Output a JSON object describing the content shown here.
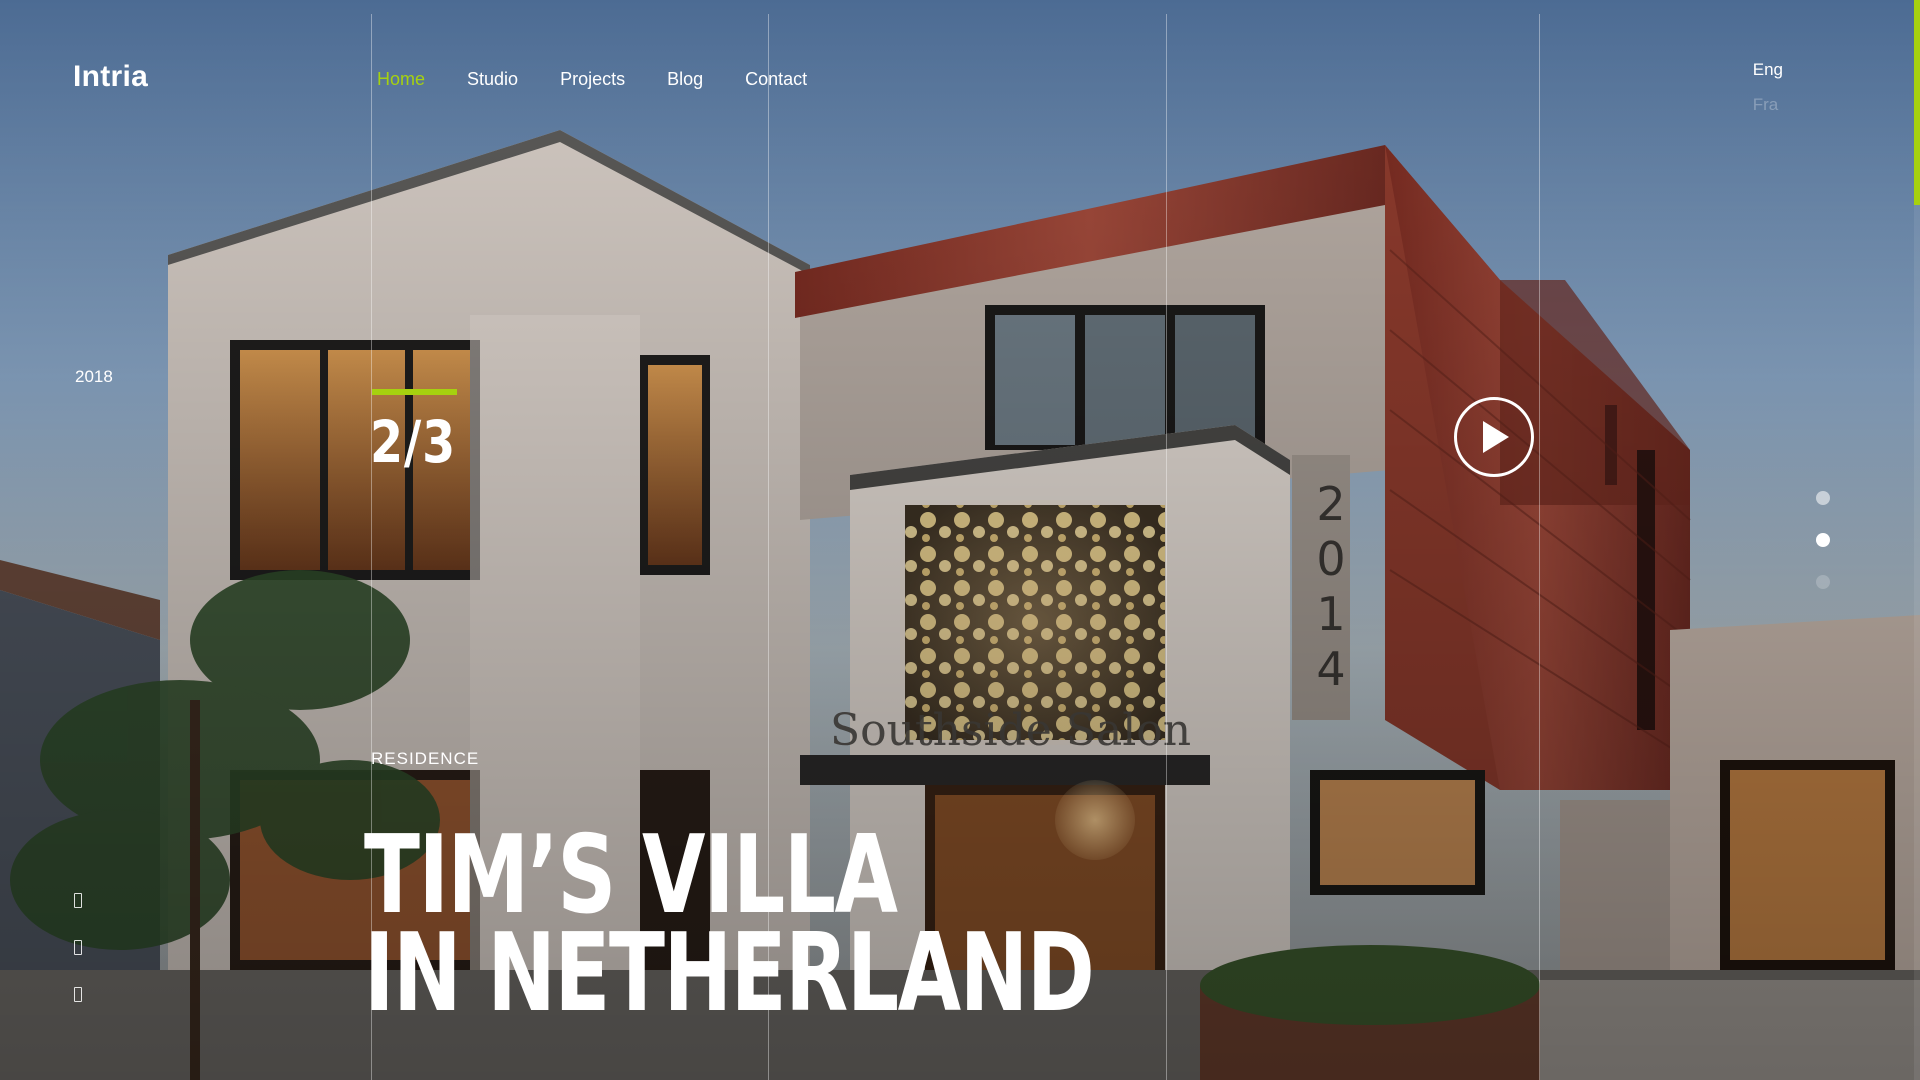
{
  "brand": {
    "logo": "Intria",
    "accent_color": "#a6d10f"
  },
  "nav": {
    "items": [
      {
        "label": "Home",
        "active": true
      },
      {
        "label": "Studio",
        "active": false
      },
      {
        "label": "Projects",
        "active": false
      },
      {
        "label": "Blog",
        "active": false
      },
      {
        "label": "Contact",
        "active": false
      }
    ]
  },
  "languages": {
    "current": "Eng",
    "other": "Fra"
  },
  "sidebar": {
    "year": "2018",
    "social_icons": [
      "facebook-icon",
      "twitter-icon",
      "instagram-icon"
    ]
  },
  "slide": {
    "counter": "2/3",
    "category": "RESIDENCE",
    "title_line1": "TIM’S VILLA",
    "title_line2": "IN NETHERLAND",
    "current_index": 2,
    "total": 3
  },
  "building": {
    "sign_text": "Southside Salon",
    "house_number": [
      "2",
      "0",
      "1",
      "4"
    ]
  },
  "play_button": {
    "icon": "play-icon"
  },
  "scroll": {
    "progress_fraction": 0.19
  }
}
